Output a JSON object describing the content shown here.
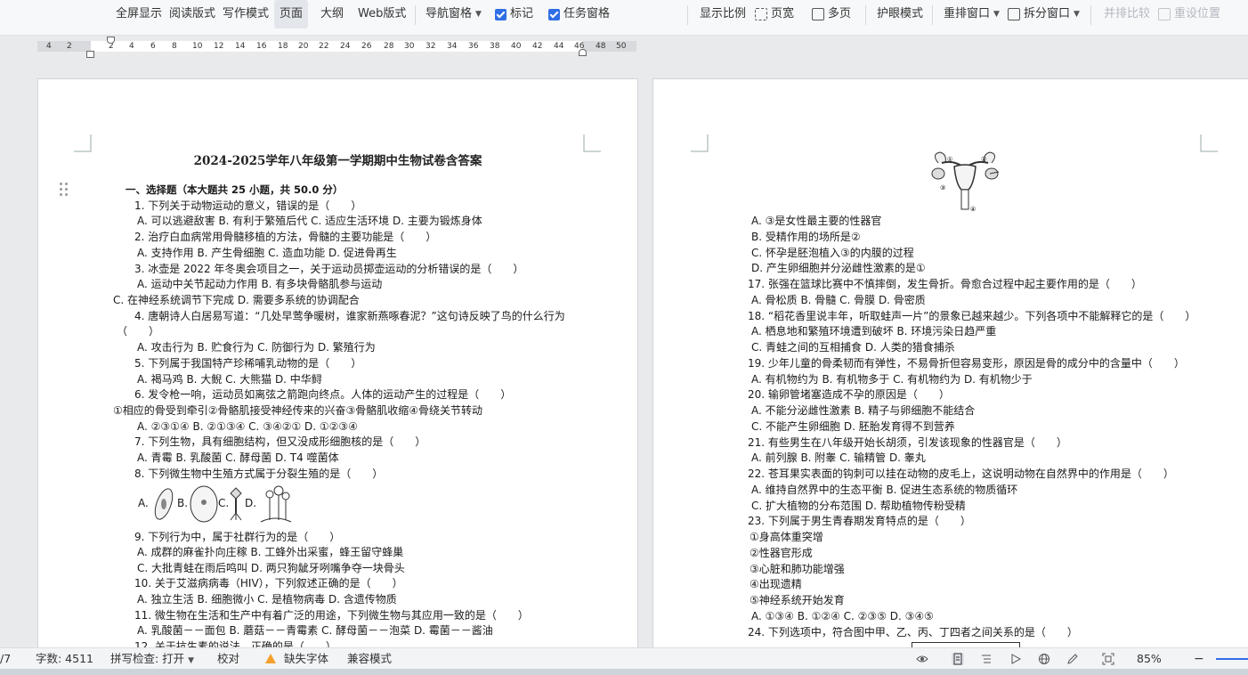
{
  "toolbar": {
    "fullscreen": "全屏显示",
    "reading_view": "阅读版式",
    "writing_mode": "写作模式",
    "page_view": "页面",
    "outline": "大纲",
    "web_view": "Web版式",
    "nav_pane": "导航窗格",
    "markup": "标记",
    "task_pane": "任务窗格",
    "zoom_ratio": "显示比例",
    "page_width": "页宽",
    "multi_page": "多页",
    "eye_mode": "护眼模式",
    "rearrange": "重排窗口",
    "split": "拆分窗口",
    "side_by_side": "并排比较",
    "reset_position": "重设位置"
  },
  "ruler": {
    "ticks": [
      "4",
      "2",
      "2",
      "4",
      "6",
      "8",
      "10",
      "12",
      "14",
      "16",
      "18",
      "20",
      "22",
      "24",
      "26",
      "28",
      "30",
      "32",
      "34",
      "36",
      "38",
      "40",
      "42",
      "44",
      "46",
      "48",
      "50"
    ]
  },
  "page1": {
    "title": "2024-2025学年八年级第一学期期中生物试卷含答案",
    "section": "一、选择题（本大题共 25 小题，共 50.0 分）",
    "lines": [
      "1. 下列关于动物运动的意义，错误的是（　　）",
      "A. 可以逃避敌害  B. 有利于繁殖后代  C. 适应生活环境  D. 主要为锻炼身体",
      "2. 治疗白血病常用骨髓移植的方法，骨髓的主要功能是（　　）",
      "A. 支持作用  B. 产生骨细胞  C. 造血功能  D. 促进骨再生",
      "3. 冰壶是 2022 年冬奥会项目之一，关于运动员掷壶运动的分析错误的是（　　）",
      "A. 运动中关节起动力作用  B. 有多块骨骼肌参与运动",
      "C. 在神经系统调节下完成  D. 需要多系统的协调配合",
      "4. 唐朝诗人白居易写道：“几处早莺争暖树，谁家新燕啄春泥？”这句诗反映了鸟的什么行为",
      "（　　）",
      "A. 攻击行为  B. 贮食行为  C. 防御行为  D. 繁殖行为",
      "5. 下列属于我国特产珍稀哺乳动物的是（　　）",
      "A. 褐马鸡  B. 大鲵  C. 大熊猫  D. 中华鲟",
      "6. 发令枪一响，运动员如离弦之箭跑向终点。人体的运动产生的过程是（　　）",
      "①相应的骨受到牵引②骨骼肌接受神经传来的兴奋③骨骼肌收缩④骨绕关节转动",
      "A. ②③①④  B. ②①③④  C. ③④②①  D. ①②③④",
      "7. 下列生物，具有细胞结构，但又没成形细胞核的是（　　）",
      "A. 青霉  B. 乳酸菌  C. 酵母菌  D. T4 噬菌体",
      "8. 下列微生物中生殖方式属于分裂生殖的是（　　）",
      "9. 下列行为中，属于社群行为的是（　　）",
      "A. 成群的麻雀扑向庄稼  B. 工蜂外出采蜜，蜂王留守蜂巢",
      "C. 大批青蛙在雨后鸣叫  D. 两只狗龇牙咧嘴争夺一块骨头",
      "10. 关于艾滋病病毒（HIV），下列叙述正确的是（　　）",
      "A. 独立生活  B. 细胞微小  C. 是植物病毒  D. 含遗传物质",
      "11. 微生物在生活和生产中有着广泛的用途，下列微生物与其应用一致的是（　　）",
      "A. 乳酸菌－－面包  B. 蘑菇－－青霉素  C. 酵母菌－－泡菜  D. 霉菌－－酱油",
      "12. 关于抗生素的说法，正确的是（　　）"
    ],
    "q8_options": [
      "A.",
      "B.",
      "C.",
      "D."
    ]
  },
  "page2": {
    "lines": [
      "A. ③是女性最主要的性器官",
      "B. 受精作用的场所是②",
      "C. 怀孕是胚泡植入③的内膜的过程",
      "D. 产生卵细胞并分泌雌性激素的是①",
      "17. 张强在篮球比赛中不慎摔倒，发生骨折。骨愈合过程中起主要作用的是（　　）",
      "A. 骨松质  B. 骨髓  C. 骨膜  D. 骨密质",
      "18. “稻花香里说丰年，听取蛙声一片”的景象已越来越少。下列各项中不能解释它的是（　　）",
      "A. 栖息地和繁殖环境遭到破坏  B. 环境污染日趋严重",
      "C. 青蛙之间的互相捕食  D. 人类的猎食捕杀",
      "19. 少年儿童的骨柔韧而有弹性，不易骨折但容易变形，原因是骨的成分中的含量中（　　）",
      "A. 有机物约为  B. 有机物多于  C. 有机物约为  D. 有机物少于",
      "20. 输卵管堵塞造成不孕的原因是（　　）",
      "A. 不能分泌雌性激素  B. 精子与卵细胞不能结合",
      "C. 不能产生卵细胞  D. 胚胎发育得不到营养",
      "21. 有些男生在八年级开始长胡须，引发该现象的性器官是（　　）",
      "A. 前列腺  B. 附睾  C. 输精管  D. 睾丸",
      "22. 苍耳果实表面的钩刺可以挂在动物的皮毛上，这说明动物在自然界中的作用是（　　）",
      "A. 维持自然界中的生态平衡  B. 促进生态系统的物质循环",
      "C. 扩大植物的分布范围  D. 帮助植物传粉受精",
      "23. 下列属于男生青春期发育特点的是（　　）",
      "①身高体重突增",
      "②性器官形成",
      "③心脏和肺功能增强",
      "④出现遗精",
      "⑤神经系统开始发育",
      "A. ①③④  B. ①②④  C. ②③⑤  D. ③④⑤",
      "24. 下列选项中，符合图中甲、乙、丙、丁四者之间关系的是（　　）"
    ],
    "figure_labels": [
      "①",
      "②",
      "③",
      "④"
    ]
  },
  "statusbar": {
    "page": "/7",
    "word_count": "字数: 4511",
    "spell_check": "拼写检查: 打开",
    "proofread": "校对",
    "missing_font": "缺失字体",
    "compat_mode": "兼容模式",
    "zoom": "85%"
  }
}
